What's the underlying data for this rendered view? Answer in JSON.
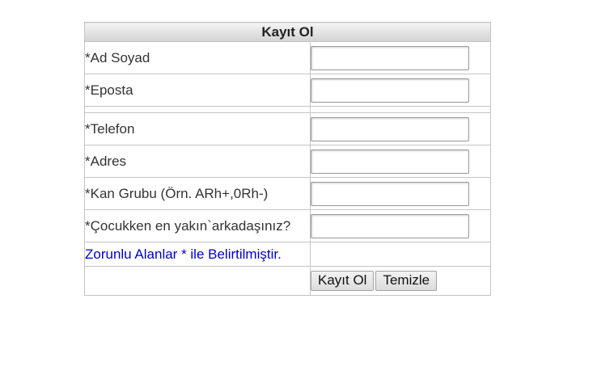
{
  "form": {
    "title": "Kayıt Ol",
    "fields": [
      {
        "label": "*Ad Soyad",
        "value": ""
      },
      {
        "label": "*Eposta",
        "value": ""
      },
      {
        "label": "*Telefon",
        "value": ""
      },
      {
        "label": "*Adres",
        "value": ""
      },
      {
        "label": "*Kan Grubu (Örn. ARh+,0Rh-)",
        "value": ""
      },
      {
        "label": "*Çocukken en yakın`arkadaşınız?",
        "value": ""
      }
    ],
    "required_note": "Zorunlu Alanlar * ile Belirtilmiştir.",
    "buttons": {
      "submit_label": "Kayıt Ol",
      "reset_label": "Temizle"
    }
  }
}
